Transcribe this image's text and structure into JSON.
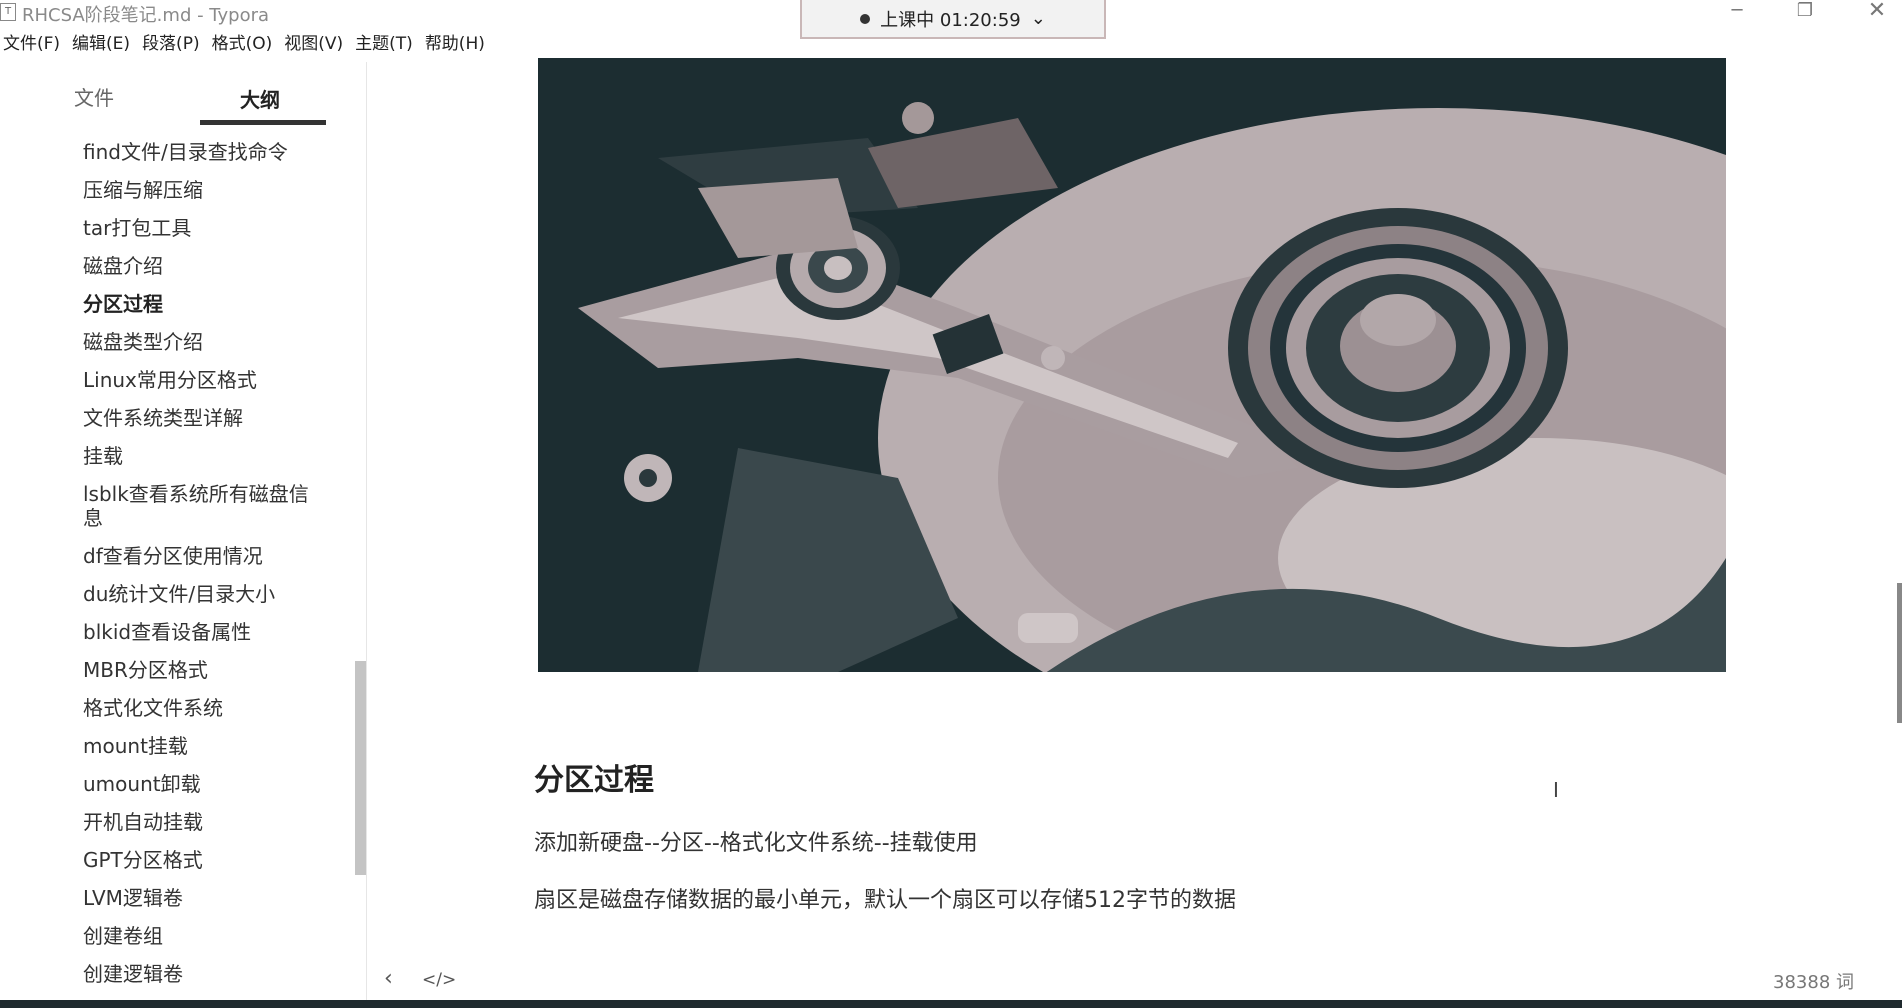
{
  "window": {
    "title": "RHCSA阶段笔记.md - Typora",
    "app_icon": "T",
    "timer_label": "上课中 01:20:59",
    "timer_chevron": "⌄",
    "minimize": "─",
    "maximize": "❐",
    "close": "✕"
  },
  "menu": [
    "文件(F)",
    "编辑(E)",
    "段落(P)",
    "格式(O)",
    "视图(V)",
    "主题(T)",
    "帮助(H)"
  ],
  "sidebar": {
    "tab_files": "文件",
    "tab_outline": "大纲",
    "outline": [
      "find文件/目录查找命令",
      "压缩与解压缩",
      "tar打包工具",
      "磁盘介绍",
      "分区过程",
      "磁盘类型介绍",
      "Linux常用分区格式",
      "文件系统类型详解",
      "挂载",
      "lsblk查看系统所有磁盘信息",
      "df查看分区使用情况",
      "du统计文件/目录大小",
      "blkid查看设备属性",
      "MBR分区格式",
      "格式化文件系统",
      "mount挂载",
      "umount卸载",
      "开机自动挂载",
      "GPT分区格式",
      "LVM逻辑卷",
      "创建卷组",
      "创建逻辑卷"
    ],
    "active_index": 4
  },
  "document": {
    "heading": "分区过程",
    "para1": "添加新硬盘--分区--格式化文件系统--挂载使用",
    "para2": "扇区是磁盘存储数据的最小单元，默认一个扇区可以存储512字节的数据",
    "cursor": "I"
  },
  "footer": {
    "prev": "‹",
    "source": "</>",
    "word_count": "38388 词"
  },
  "colors": {
    "hero_bg": "#1c2d31",
    "platter": "#b9aeb0",
    "accent": "#333333"
  }
}
